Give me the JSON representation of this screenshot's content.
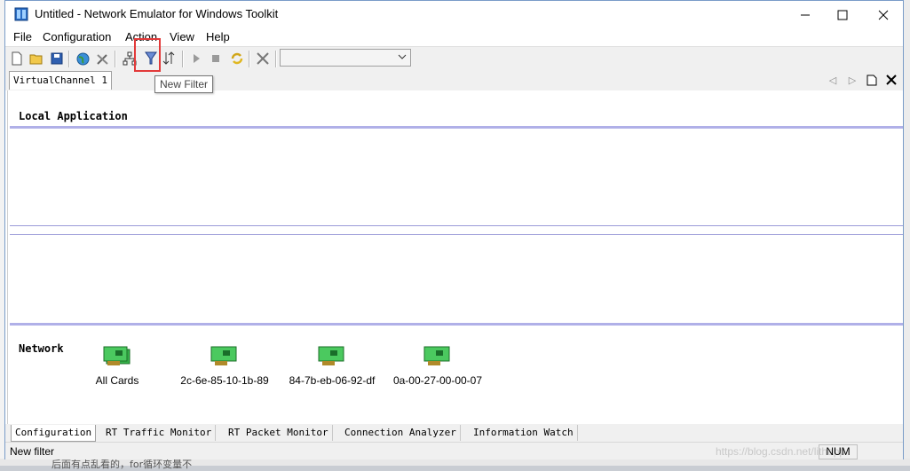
{
  "window": {
    "title": "Untitled - Network Emulator for Windows Toolkit",
    "controls": {
      "minimize": "—",
      "maximize": "☐",
      "close": "✕"
    }
  },
  "menu": [
    "File",
    "Configuration",
    "Action",
    "View",
    "Help"
  ],
  "toolbar": {
    "icons": [
      "new-document-icon",
      "open-folder-icon",
      "save-icon",
      "globe-icon",
      "tools-icon",
      "network-topology-icon",
      "filter-icon",
      "sort-icon",
      "play-icon",
      "stop-icon",
      "refresh-icon",
      "disconnect-icon"
    ],
    "combo_value": ""
  },
  "tooltip": "New Filter",
  "document_tab": "VirtualChannel 1",
  "sections": {
    "local": "Local Application",
    "network": "Network"
  },
  "cards": [
    {
      "label": "All Cards"
    },
    {
      "label": "2c-6e-85-10-1b-89"
    },
    {
      "label": "84-7b-eb-06-92-df"
    },
    {
      "label": "0a-00-27-00-00-07"
    }
  ],
  "bottom_tabs": [
    "Configuration",
    "RT Traffic Monitor",
    "RT Packet Monitor",
    "Connection Analyzer",
    "Information Watch"
  ],
  "status": {
    "text": "New filter",
    "num": "NUM",
    "watermark": "https://blog.csdn.net/lithapp"
  },
  "background_text": "后面有点乱看的，for循环变量不"
}
